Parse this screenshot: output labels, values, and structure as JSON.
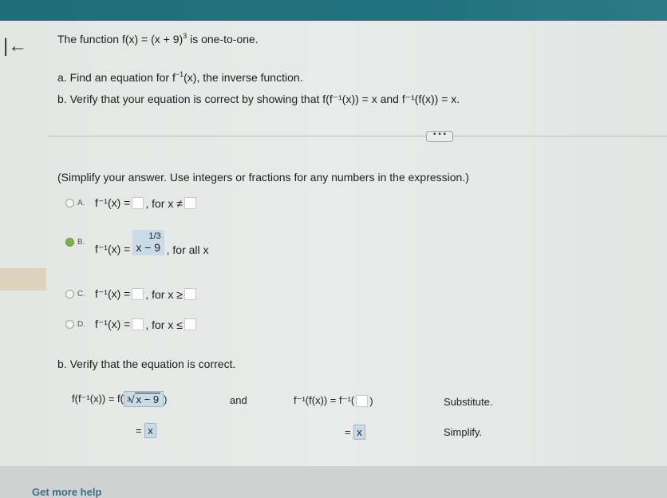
{
  "question": {
    "title_prefix": "The function",
    "function_expr": "f(x) = (x + 9)",
    "function_exp": "3",
    "title_suffix": "is one-to-one.",
    "part_a_prefix": "a. Find an equation for f",
    "part_a_sup": "−1",
    "part_a_suffix": "(x), the inverse function.",
    "part_b": "b. Verify that your equation is correct by showing that f(f⁻¹(x)) = x and f⁻¹(f(x)) = x."
  },
  "more_button": "• • •",
  "instruction": "(Simplify your answer. Use integers or fractions for any numbers in the expression.)",
  "options": [
    {
      "letter": "A.",
      "lhs": "f⁻¹(x) =",
      "cond": ", for x ≠"
    },
    {
      "letter": "B.",
      "lhs": "f⁻¹(x) =",
      "ans_exp": "1/3",
      "ans_base": "x",
      "ans_rest": " − 9",
      "cond": ", for all x"
    },
    {
      "letter": "C.",
      "lhs": "f⁻¹(x) =",
      "cond": ", for x ≥"
    },
    {
      "letter": "D.",
      "lhs": "f⁻¹(x) =",
      "cond": ", for x ≤"
    }
  ],
  "verify": {
    "heading": "b. Verify that the equation is correct.",
    "left_expr": "f(f⁻¹(x)) = f(",
    "left_radical_index": "3",
    "left_radical_body": "x − 9",
    "left_close": ")",
    "and": "and",
    "right_expr": "f⁻¹(f(x)) = f⁻¹(",
    "right_close": ")",
    "substitute": "Substitute.",
    "eq_left": "=",
    "eq_left_val": "x",
    "eq_right": "=",
    "eq_right_val": "x",
    "simplify": "Simplify."
  },
  "help": "Get more help"
}
